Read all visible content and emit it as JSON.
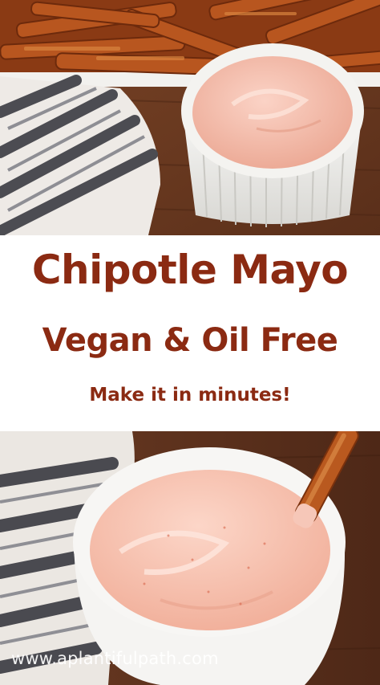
{
  "banner": {
    "title": "Chipotle Mayo",
    "subtitle": "Vegan & Oil Free",
    "tagline": "Make it in minutes!"
  },
  "watermark": "www.aplantifulpath.com",
  "colors": {
    "text": "#8b2a12",
    "banner_bg": "#ffffff",
    "sauce": "#f4b8a6",
    "wood": "#6b3b22"
  }
}
